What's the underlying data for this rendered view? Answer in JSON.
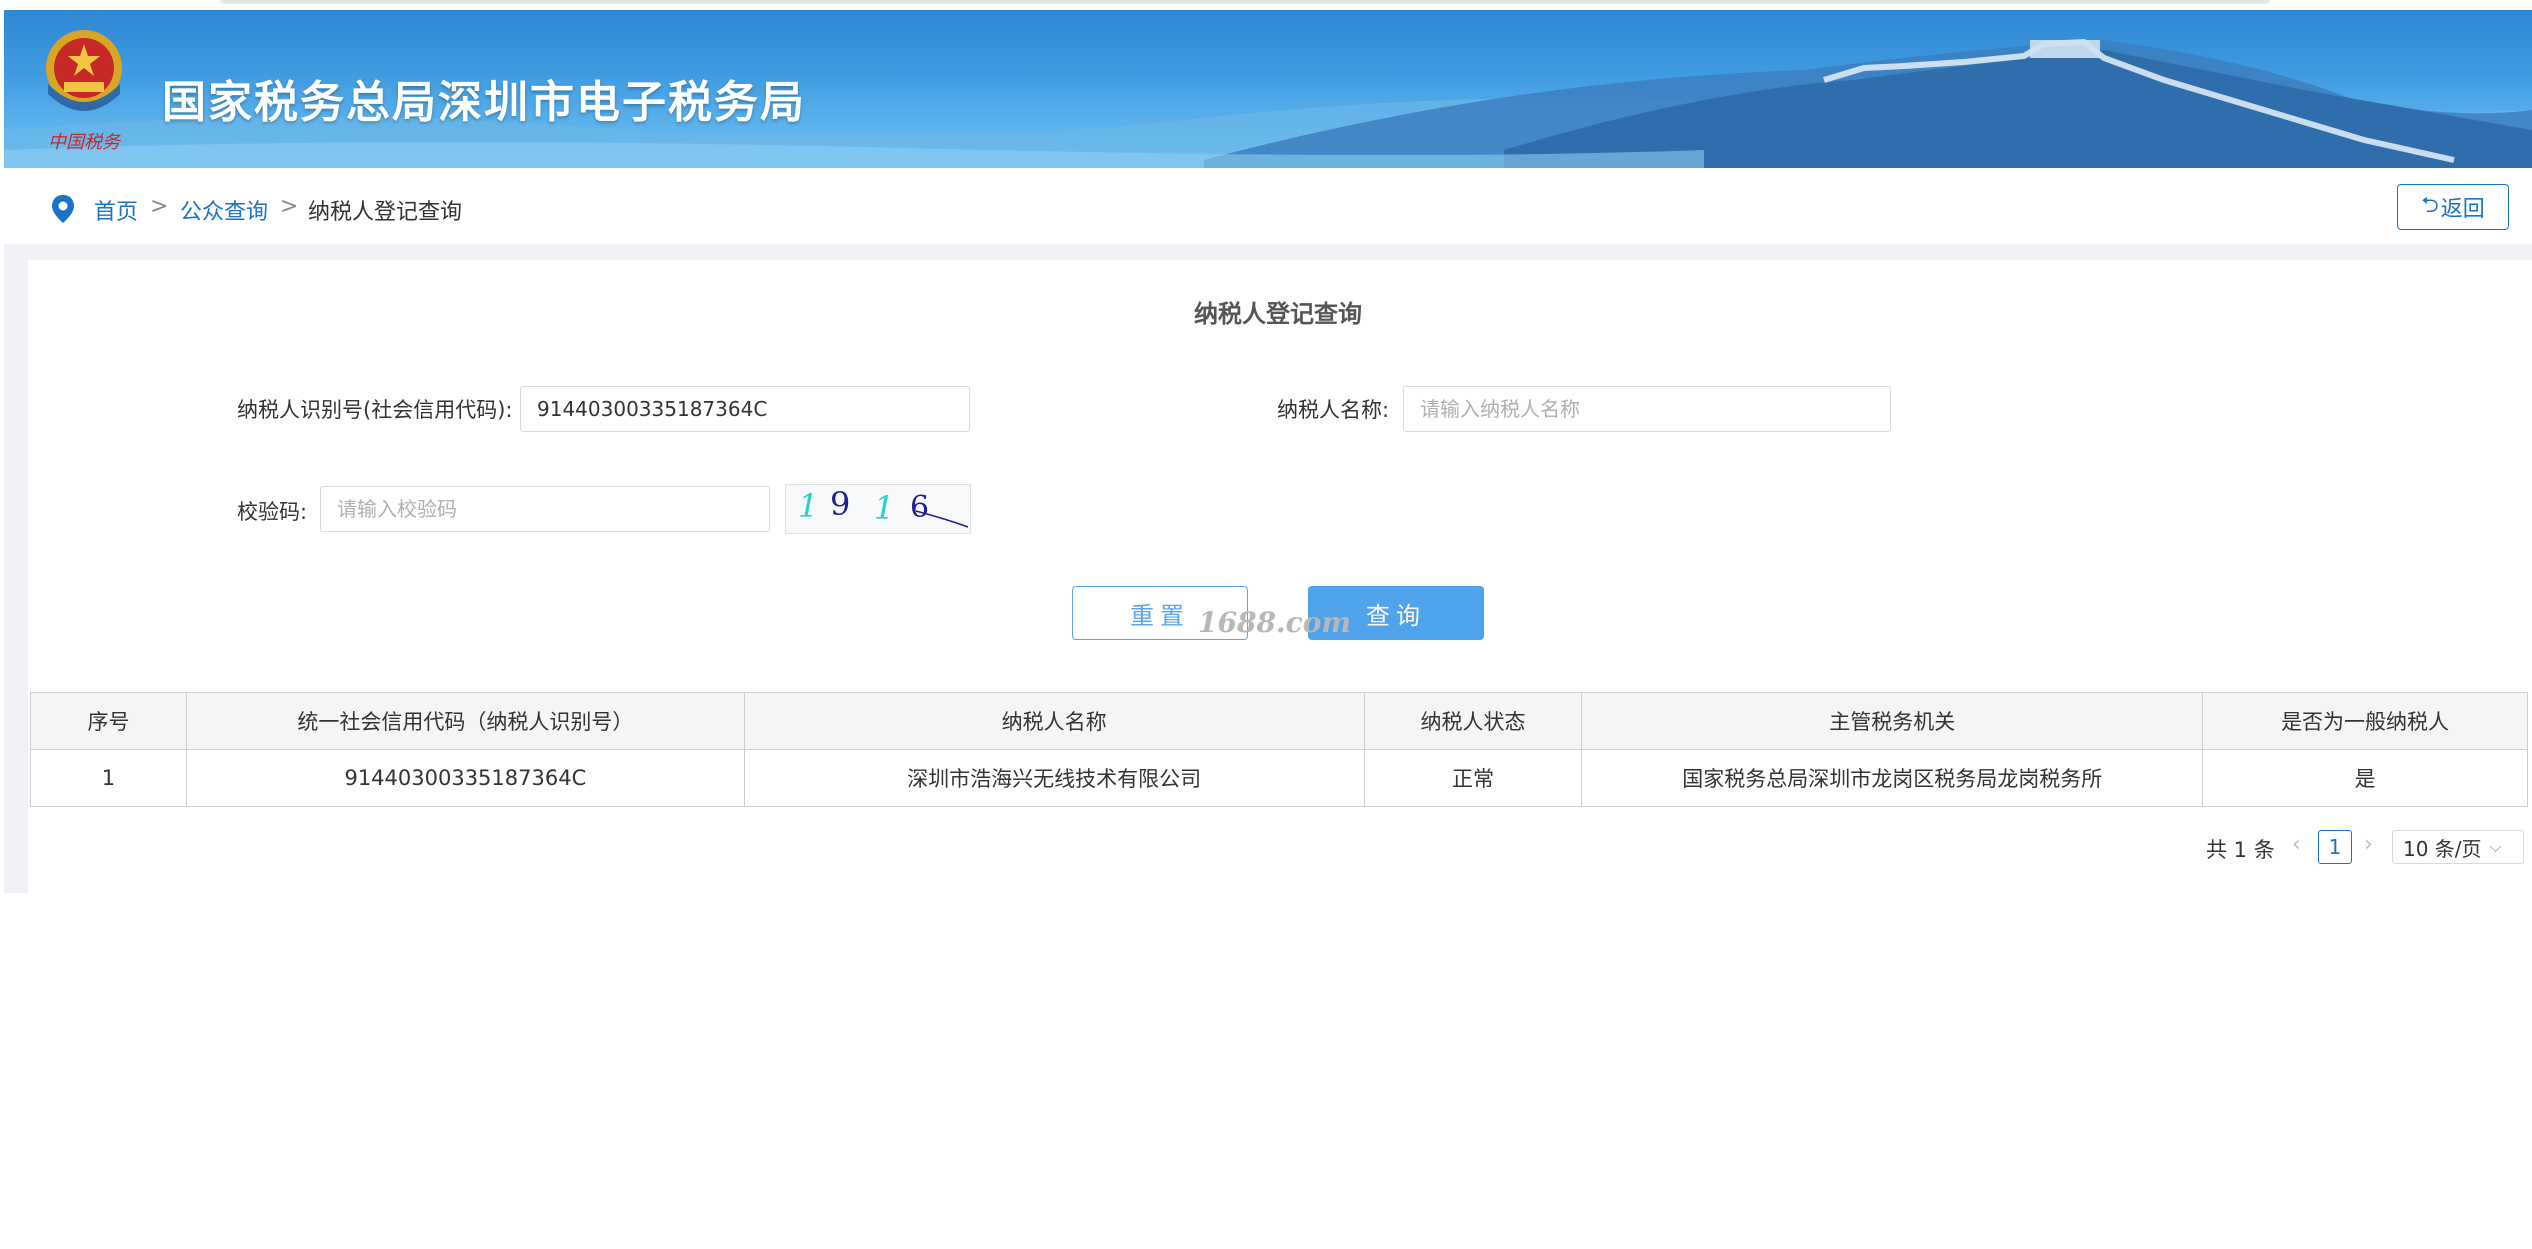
{
  "header": {
    "site_title": "国家税务总局深圳市电子税务局",
    "emblem_caption": "中国税务"
  },
  "breadcrumb": {
    "items": [
      {
        "label": "首页"
      },
      {
        "label": "公众查询"
      },
      {
        "label": "纳税人登记查询"
      }
    ],
    "separator": ">",
    "back_label": "返回",
    "back_icon": "undo-icon"
  },
  "form": {
    "title": "纳税人登记查询",
    "taxpayer_id_label": "纳税人识别号(社会信用代码):",
    "taxpayer_id_value": "91440300335187364C",
    "taxpayer_name_label": "纳税人名称:",
    "taxpayer_name_placeholder": "请输入纳税人名称",
    "captcha_label": "校验码:",
    "captcha_placeholder": "请输入校验码",
    "captcha_image_text": "1916",
    "reset_label": "重置",
    "query_label": "查询"
  },
  "watermark": "1688.com",
  "table": {
    "columns": [
      "序号",
      "统一社会信用代码（纳税人识别号）",
      "纳税人名称",
      "纳税人状态",
      "主管税务机关",
      "是否为一般纳税人"
    ],
    "rows": [
      [
        "1",
        "91440300335187364C",
        "深圳市浩海兴无线技术有限公司",
        "正常",
        "国家税务总局深圳市龙岗区税务局龙岗税务所",
        "是"
      ]
    ]
  },
  "pagination": {
    "total_text": "共 1 条",
    "current_page": "1",
    "page_size": "10 条/页"
  },
  "colors": {
    "accent": "#1a73c9",
    "button_primary": "#4ea3eb",
    "banner": "#3f9be0"
  }
}
